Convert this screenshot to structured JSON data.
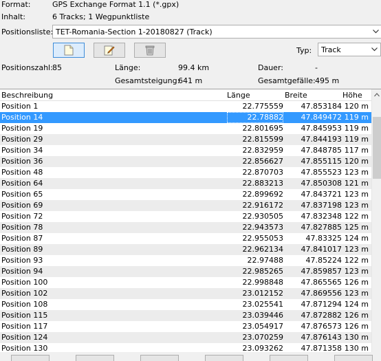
{
  "header": {
    "format_label": "Format:",
    "format_value": "GPS Exchange Format 1.1 (*.gpx)",
    "content_label": "Inhalt:",
    "content_value": "6 Tracks; 1 Wegpunktliste",
    "poslist_label": "Positionsliste:",
    "poslist_value": "TET-Romania-Section 1-20180827 (Track)"
  },
  "toolbar": {
    "new_icon": "new-document-icon",
    "edit_icon": "edit-icon",
    "delete_icon": "trash-can-icon",
    "type_label": "Typ:",
    "type_value": "Track"
  },
  "stats": {
    "count_label": "Positionszahl:",
    "count_value": "85",
    "length_label": "Länge:",
    "length_value": "99.4 km",
    "duration_label": "Dauer:",
    "duration_value": "-",
    "ascent_label": "Gesamtsteigung:",
    "ascent_value": "641 m",
    "descent_label": "Gesamtgefälle:",
    "descent_value": "495 m"
  },
  "table": {
    "columns": [
      "Beschreibung",
      "Länge",
      "Breite",
      "Höhe"
    ],
    "rows": [
      [
        "Position 1",
        "22.775559",
        "47.853184",
        "120 m"
      ],
      [
        "Position 14",
        "22.78882",
        "47.849472",
        "119 m"
      ],
      [
        "Position 19",
        "22.801695",
        "47.845953",
        "119 m"
      ],
      [
        "Position 29",
        "22.815599",
        "47.844193",
        "119 m"
      ],
      [
        "Position 34",
        "22.832959",
        "47.848785",
        "117 m"
      ],
      [
        "Position 36",
        "22.856627",
        "47.855115",
        "120 m"
      ],
      [
        "Position 48",
        "22.870703",
        "47.855523",
        "123 m"
      ],
      [
        "Position 64",
        "22.883213",
        "47.850308",
        "121 m"
      ],
      [
        "Position 65",
        "22.899692",
        "47.843721",
        "123 m"
      ],
      [
        "Position 69",
        "22.916172",
        "47.837198",
        "123 m"
      ],
      [
        "Position 72",
        "22.930505",
        "47.832348",
        "122 m"
      ],
      [
        "Position 78",
        "22.943573",
        "47.827885",
        "125 m"
      ],
      [
        "Position 87",
        "22.955053",
        "47.83325",
        "124 m"
      ],
      [
        "Position 89",
        "22.962134",
        "47.841017",
        "123 m"
      ],
      [
        "Position 93",
        "22.97488",
        "47.85224",
        "122 m"
      ],
      [
        "Position 94",
        "22.985265",
        "47.859857",
        "123 m"
      ],
      [
        "Position 100",
        "22.998848",
        "47.865565",
        "126 m"
      ],
      [
        "Position 102",
        "23.012152",
        "47.869556",
        "123 m"
      ],
      [
        "Position 108",
        "23.025541",
        "47.871294",
        "124 m"
      ],
      [
        "Position 115",
        "23.039446",
        "47.872882",
        "126 m"
      ],
      [
        "Position 117",
        "23.054917",
        "47.876573",
        "126 m"
      ],
      [
        "Position 124",
        "23.070259",
        "47.876143",
        "130 m"
      ],
      [
        "Position 130",
        "23.093262",
        "47.871358",
        "130 m"
      ]
    ],
    "selected_index": 1
  },
  "colors": {
    "selection": "#3399ff",
    "window_bg": "#f0f0f0"
  }
}
